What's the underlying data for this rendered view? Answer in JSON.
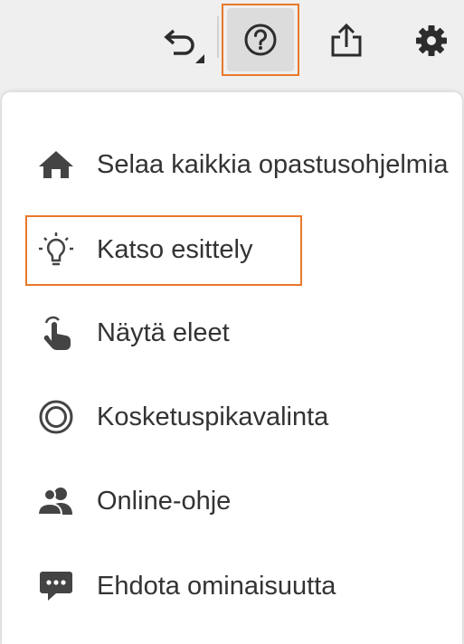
{
  "toolbar": {
    "icons": [
      "undo-icon",
      "help-icon",
      "share-icon",
      "settings-icon"
    ],
    "highlight_color": "#e8782b"
  },
  "menu": {
    "items": [
      {
        "icon": "home-icon",
        "label": "Selaa kaikkia opastusohjelmia"
      },
      {
        "icon": "lightbulb-icon",
        "label": "Katso esittely"
      },
      {
        "icon": "gesture-icon",
        "label": "Näytä eleet"
      },
      {
        "icon": "touch-shortcut-icon",
        "label": "Kosketuspikavalinta"
      },
      {
        "icon": "people-icon",
        "label": "Online-ohje"
      },
      {
        "icon": "chat-icon",
        "label": "Ehdota ominaisuutta"
      }
    ]
  }
}
